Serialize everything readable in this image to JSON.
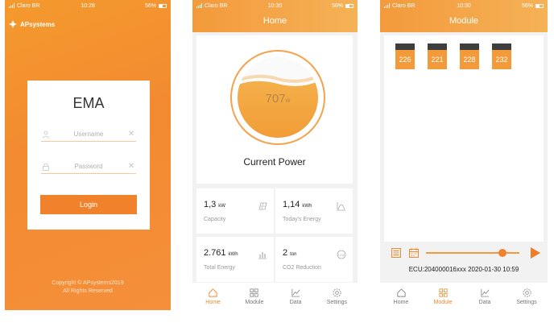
{
  "status": {
    "carrier": "Claro BR",
    "battery": "56%",
    "login_time": "10:28",
    "home_time": "10:30",
    "module_time": "10:30"
  },
  "login": {
    "brand": "APsystems",
    "app_title": "EMA",
    "username_placeholder": "Username",
    "password_placeholder": "Password",
    "login_button": "Login",
    "copyright_line1": "Copyright © APsystems2019",
    "copyright_line2": "All Rights Reserved"
  },
  "home": {
    "title": "Home",
    "power_value": "707",
    "power_unit": "w",
    "current_power_label": "Current Power",
    "stats": [
      {
        "value": "1,3",
        "unit": "kW",
        "label": "Capacity",
        "icon": "solar-panel-icon"
      },
      {
        "value": "1,14",
        "unit": "kWh",
        "label": "Today's Energy",
        "icon": "energy-chart-icon"
      },
      {
        "value": "2.761",
        "unit": "kWh",
        "label": "Total Energy",
        "icon": "bar-chart-icon"
      },
      {
        "value": "2",
        "unit": "ton",
        "label": "CO2 Reduction",
        "icon": "co2-icon"
      }
    ]
  },
  "module": {
    "title": "Module",
    "panels": [
      "226",
      "221",
      "228",
      "232"
    ],
    "ecu_info": "ECU:204000016xxx 2020-01-30 10:59",
    "slider_fraction": 0.82
  },
  "tabs": [
    "Home",
    "Module",
    "Data",
    "Settings"
  ],
  "colors": {
    "accent": "#f0822c",
    "header_start": "#f39a3c",
    "header_end": "#f5b256",
    "panel_body": "#f39b3a"
  }
}
